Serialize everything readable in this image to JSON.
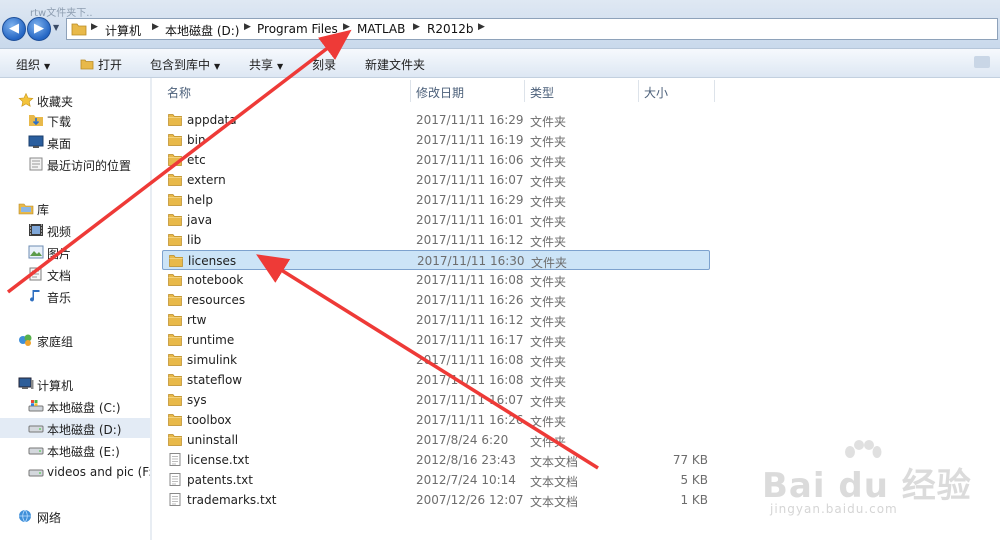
{
  "window": {
    "faded_title": "rtw文件夹下.."
  },
  "address": {
    "crumbs": [
      "计算机",
      "本地磁盘 (D:)",
      "Program Files",
      "MATLAB",
      "R2012b"
    ]
  },
  "toolbar": {
    "organize": "组织",
    "open": "打开",
    "include_in_library": "包含到库中",
    "share": "共享",
    "burn": "刻录",
    "new_folder": "新建文件夹"
  },
  "sidebar": {
    "favorites": "收藏夹",
    "downloads": "下载",
    "desktop": "桌面",
    "recent": "最近访问的位置",
    "libraries": "库",
    "videos": "视频",
    "pictures": "图片",
    "documents": "文档",
    "music": "音乐",
    "homegroup": "家庭组",
    "computer": "计算机",
    "drive_c": "本地磁盘 (C:)",
    "drive_d": "本地磁盘 (D:)",
    "drive_e": "本地磁盘 (E:)",
    "drive_f": "videos and pic (F:)",
    "network": "网络"
  },
  "columns": {
    "name": "名称",
    "modified": "修改日期",
    "type": "类型",
    "size": "大小"
  },
  "files": [
    {
      "name": "appdata",
      "date": "2017/11/11 16:29",
      "type": "文件夹",
      "size": "",
      "kind": "folder"
    },
    {
      "name": "bin",
      "date": "2017/11/11 16:19",
      "type": "文件夹",
      "size": "",
      "kind": "folder"
    },
    {
      "name": "etc",
      "date": "2017/11/11 16:06",
      "type": "文件夹",
      "size": "",
      "kind": "folder"
    },
    {
      "name": "extern",
      "date": "2017/11/11 16:07",
      "type": "文件夹",
      "size": "",
      "kind": "folder"
    },
    {
      "name": "help",
      "date": "2017/11/11 16:29",
      "type": "文件夹",
      "size": "",
      "kind": "folder"
    },
    {
      "name": "java",
      "date": "2017/11/11 16:01",
      "type": "文件夹",
      "size": "",
      "kind": "folder"
    },
    {
      "name": "lib",
      "date": "2017/11/11 16:12",
      "type": "文件夹",
      "size": "",
      "kind": "folder"
    },
    {
      "name": "licenses",
      "date": "2017/11/11 16:30",
      "type": "文件夹",
      "size": "",
      "kind": "folder",
      "selected": true
    },
    {
      "name": "notebook",
      "date": "2017/11/11 16:08",
      "type": "文件夹",
      "size": "",
      "kind": "folder"
    },
    {
      "name": "resources",
      "date": "2017/11/11 16:26",
      "type": "文件夹",
      "size": "",
      "kind": "folder"
    },
    {
      "name": "rtw",
      "date": "2017/11/11 16:12",
      "type": "文件夹",
      "size": "",
      "kind": "folder"
    },
    {
      "name": "runtime",
      "date": "2017/11/11 16:17",
      "type": "文件夹",
      "size": "",
      "kind": "folder"
    },
    {
      "name": "simulink",
      "date": "2017/11/11 16:08",
      "type": "文件夹",
      "size": "",
      "kind": "folder"
    },
    {
      "name": "stateflow",
      "date": "2017/11/11 16:08",
      "type": "文件夹",
      "size": "",
      "kind": "folder"
    },
    {
      "name": "sys",
      "date": "2017/11/11 16:07",
      "type": "文件夹",
      "size": "",
      "kind": "folder"
    },
    {
      "name": "toolbox",
      "date": "2017/11/11 16:26",
      "type": "文件夹",
      "size": "",
      "kind": "folder"
    },
    {
      "name": "uninstall",
      "date": "2017/8/24 6:20",
      "type": "文件夹",
      "size": "",
      "kind": "folder"
    },
    {
      "name": "license.txt",
      "date": "2012/8/16 23:43",
      "type": "文本文档",
      "size": "77 KB",
      "kind": "text"
    },
    {
      "name": "patents.txt",
      "date": "2012/7/24 10:14",
      "type": "文本文档",
      "size": "5 KB",
      "kind": "text"
    },
    {
      "name": "trademarks.txt",
      "date": "2007/12/26 12:07",
      "type": "文本文档",
      "size": "1 KB",
      "kind": "text"
    }
  ],
  "watermark": {
    "brand": "Bai du 经验",
    "url": "jingyan.baidu.com"
  },
  "colors": {
    "annotation_arrow": "#ee3a37",
    "selection": "#cce4f7",
    "folder": "#e8b94a"
  }
}
